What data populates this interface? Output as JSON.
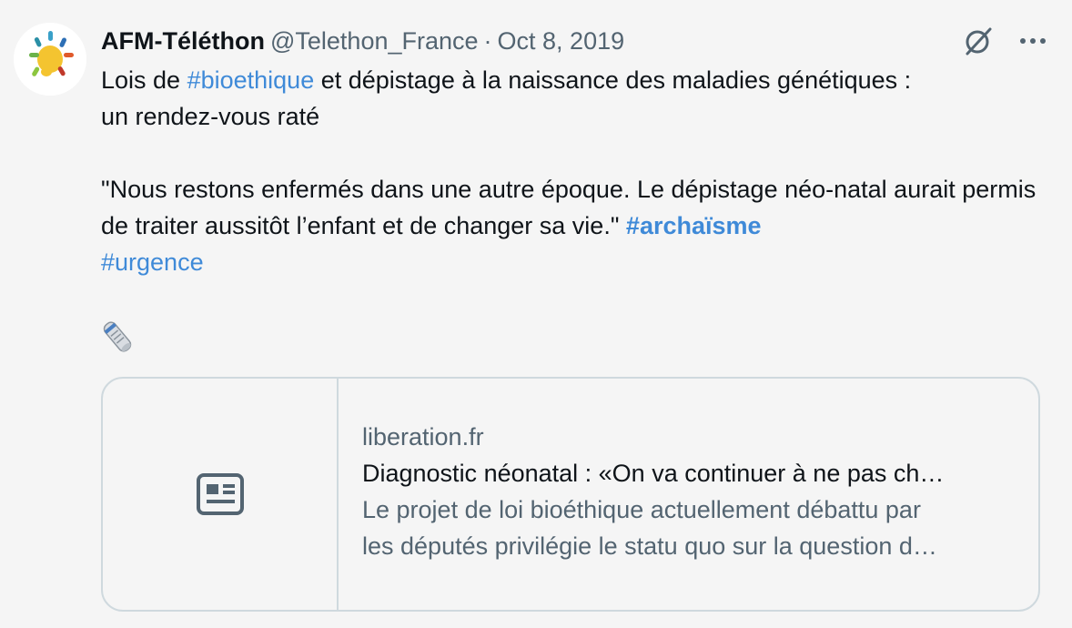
{
  "author": {
    "name": "AFM-Téléthon",
    "handle": "@Telethon_France",
    "separator": "·",
    "date": "Oct 8, 2019",
    "avatar_icon": "afm-telethon-logo"
  },
  "actions": {
    "grok_icon": "grok-icon",
    "more_icon": "more-options-icon"
  },
  "tweet": {
    "line1_prefix": "Lois de ",
    "hashtag_bioethique": "#bioethique",
    "line1_suffix": " et dépistage à la naissance des maladies génétiques :",
    "line2": "un rendez-vous raté",
    "quote": "\"Nous restons enfermés dans une autre époque. Le dépistage néo-natal aurait permis de traiter aussitôt l’enfant et de changer sa vie.\" ",
    "hashtag_archaisme": "#archaïsme",
    "hashtag_urgence": "#urgence",
    "emoji": "rolled-newspaper-emoji"
  },
  "link_card": {
    "thumb_icon": "news-article-icon",
    "domain": "liberation.fr",
    "title": "Diagnostic néonatal : «On va continuer à ne pas ch…",
    "description_line1": "Le projet de loi bioéthique actuellement débattu par",
    "description_line2": "les députés privilégie le statu quo sur la question d…"
  },
  "colors": {
    "background": "#f5f5f5",
    "hashtag": "#3f8ad8",
    "secondary_text": "#536471",
    "border": "#cfd9de"
  }
}
